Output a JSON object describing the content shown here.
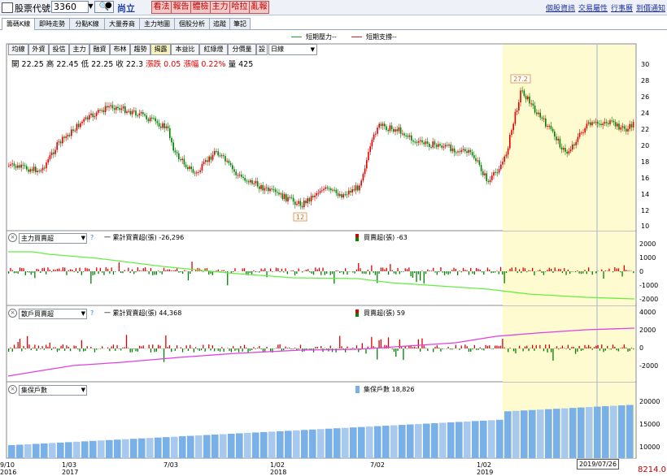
{
  "toolbar": {
    "label": "股票代號:",
    "code": "3360",
    "name": "尚立",
    "buttons": [
      "看法",
      "報告",
      "體檢",
      "主力",
      "哈拉",
      "亂報"
    ],
    "links": [
      "個股資訊",
      "交易屬性",
      "行事曆",
      "到價通知"
    ]
  },
  "tabs": [
    "籌碼K線",
    "即時走勢",
    "分點K線",
    "大量券商",
    "主力地圖",
    "個股分析",
    "追蹤",
    "筆記"
  ],
  "legend": {
    "resistance": "短期壓力--",
    "support": "短期支撐--"
  },
  "indicator_buttons": [
    "均線",
    "外資",
    "投信",
    "主力",
    "融資",
    "布林",
    "趨勢",
    "揭露",
    "本益比",
    "紅綠燈",
    "分價量",
    "設"
  ],
  "period": "日線",
  "quote": {
    "open_label": "開",
    "open": "22.25",
    "high_label": "高",
    "high": "22.45",
    "low_label": "低",
    "low": "22.25",
    "close_label": "收",
    "close": "22.3",
    "chg_label": "漲跌",
    "chg": "0.05",
    "pct_label": "漲幅",
    "pct": "0.22%",
    "vol_label": "量",
    "vol": "425"
  },
  "marks": {
    "high": "27.2",
    "low": "12"
  },
  "panels": {
    "p1": {
      "select": "主力買賣超",
      "cum": "一 累計買賣超(張) -26,296",
      "net": "買賣超(張) -63"
    },
    "p2": {
      "select": "散戶買賣超",
      "cum": "一 累計買賣超(張) 44,368",
      "net": "買賣超(張) 59"
    },
    "p3": {
      "select": "集保戶數",
      "val": "集保戶數 18,826"
    }
  },
  "axes": {
    "main_y": [
      "30",
      "28",
      "26",
      "24",
      "22",
      "20",
      "18",
      "16",
      "14",
      "12",
      "10"
    ],
    "p1_y": [
      "2000",
      "1000",
      "0",
      "-1000",
      "-2000"
    ],
    "p2_y": [
      "4000",
      "2000",
      "0",
      "-2000"
    ],
    "p3_y": [
      "20000",
      "15000",
      "10000"
    ],
    "x": [
      {
        "t": "9/10",
        "y2": "2016"
      },
      {
        "t": "1/03",
        "y2": "2017"
      },
      {
        "t": "7/03",
        "y2": ""
      },
      {
        "t": "1/02",
        "y2": "2018"
      },
      {
        "t": "7/02",
        "y2": ""
      },
      {
        "t": "1/02",
        "y2": "2019"
      }
    ]
  },
  "cursor_date": "2019/07/26",
  "last_value": "8214.0",
  "colors": {
    "up": "#e00000",
    "down": "#008000",
    "cum1": "#66ee44",
    "cum2": "#e040e0",
    "bars": "#7ab0e8",
    "highlight": "#fffbd0"
  }
}
